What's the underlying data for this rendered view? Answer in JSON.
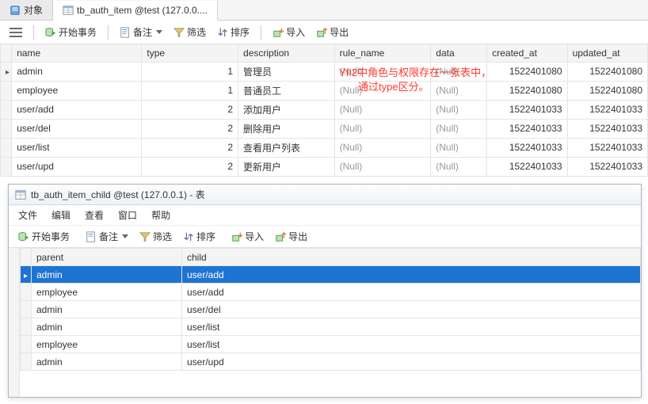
{
  "tabs": {
    "objects": "对象",
    "table": "tb_auth_item @test (127.0.0...."
  },
  "toolbar": {
    "begin_tx": "开始事务",
    "memo": "备注",
    "filter": "筛选",
    "sort": "排序",
    "import": "导入",
    "export": "导出"
  },
  "columns": [
    "name",
    "type",
    "description",
    "rule_name",
    "data",
    "created_at",
    "updated_at"
  ],
  "rows": [
    {
      "name": "admin",
      "type": 1,
      "description": "管理员",
      "rule_name": "(Null)",
      "data": "(Null)",
      "created_at": 1522401080,
      "updated_at": 1522401080
    },
    {
      "name": "employee",
      "type": 1,
      "description": "普通员工",
      "rule_name": "(Null)",
      "data": "(Null)",
      "created_at": 1522401080,
      "updated_at": 1522401080
    },
    {
      "name": "user/add",
      "type": 2,
      "description": "添加用户",
      "rule_name": "(Null)",
      "data": "(Null)",
      "created_at": 1522401033,
      "updated_at": 1522401033
    },
    {
      "name": "user/del",
      "type": 2,
      "description": "删除用户",
      "rule_name": "(Null)",
      "data": "(Null)",
      "created_at": 1522401033,
      "updated_at": 1522401033
    },
    {
      "name": "user/list",
      "type": 2,
      "description": "查看用户列表",
      "rule_name": "(Null)",
      "data": "(Null)",
      "created_at": 1522401033,
      "updated_at": 1522401033
    },
    {
      "name": "user/upd",
      "type": 2,
      "description": "更新用户",
      "rule_name": "(Null)",
      "data": "(Null)",
      "created_at": 1522401033,
      "updated_at": 1522401033
    }
  ],
  "annotation": {
    "line1": "YII2中角色与权限存在一张表中，",
    "line2": "通过type区分。"
  },
  "child": {
    "title": "tb_auth_item_child @test (127.0.0.1) - 表",
    "menu": {
      "file": "文件",
      "edit": "编辑",
      "view": "查看",
      "window": "窗口",
      "help": "帮助"
    },
    "toolbar": {
      "begin_tx": "开始事务",
      "memo": "备注",
      "filter": "筛选",
      "sort": "排序",
      "import": "导入",
      "export": "导出"
    },
    "columns": [
      "parent",
      "child"
    ],
    "rows": [
      {
        "parent": "admin",
        "child": "user/add"
      },
      {
        "parent": "employee",
        "child": "user/add"
      },
      {
        "parent": "admin",
        "child": "user/del"
      },
      {
        "parent": "admin",
        "child": "user/list"
      },
      {
        "parent": "employee",
        "child": "user/list"
      },
      {
        "parent": "admin",
        "child": "user/upd"
      }
    ],
    "selected_index": 0
  }
}
